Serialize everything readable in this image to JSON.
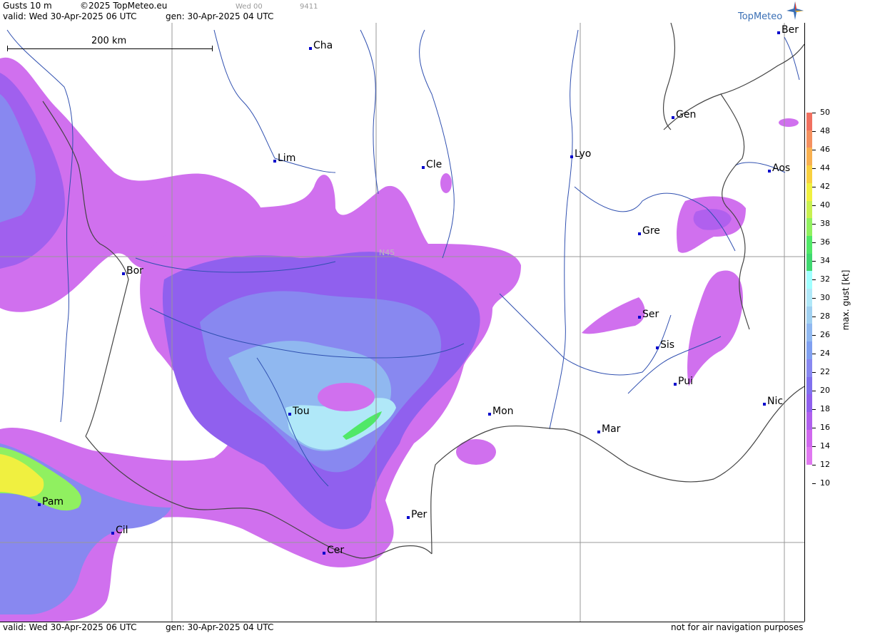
{
  "header": {
    "product": "Gusts 10 m",
    "copyright": "©2025 TopMeteo.eu",
    "step": "Wed 00",
    "code": "9411",
    "valid": "valid:  Wed  30-Apr-2025  06 UTC",
    "gen": "gen: 30-Apr-2025 04 UTC",
    "brand": "TopMeteo"
  },
  "map": {
    "scale_label": "200 km",
    "grid_label": "N45",
    "cities": [
      {
        "name": "Cha"
      },
      {
        "name": "Ber"
      },
      {
        "name": "Gen"
      },
      {
        "name": "Lim"
      },
      {
        "name": "Cle"
      },
      {
        "name": "Lyo"
      },
      {
        "name": "Aos"
      },
      {
        "name": "Gre"
      },
      {
        "name": "Bor"
      },
      {
        "name": "Ser"
      },
      {
        "name": "Sis"
      },
      {
        "name": "Pui"
      },
      {
        "name": "Tou"
      },
      {
        "name": "Mon"
      },
      {
        "name": "Nic"
      },
      {
        "name": "Mar"
      },
      {
        "name": "Pam"
      },
      {
        "name": "Per"
      },
      {
        "name": "Cil"
      },
      {
        "name": "Cer"
      }
    ]
  },
  "legend": {
    "title": "max. gust  [kt]",
    "ticks": [
      "50",
      "48",
      "46",
      "44",
      "42",
      "40",
      "38",
      "36",
      "34",
      "32",
      "30",
      "28",
      "26",
      "24",
      "22",
      "20",
      "18",
      "16",
      "14",
      "12",
      "10"
    ],
    "colors": [
      "#f07060",
      "#f49060",
      "#f8b050",
      "#f8d040",
      "#f0f040",
      "#c8f050",
      "#90f060",
      "#50e868",
      "#40d870",
      "#a0ffff",
      "#b0e8f8",
      "#a0d0f0",
      "#90b8f0",
      "#80a0f0",
      "#8888f0",
      "#8070ee",
      "#9060ee",
      "#b060ee",
      "#d068ee",
      "#e078f0"
    ]
  },
  "footer": {
    "valid": "valid:  Wed  30-Apr-2025  06 UTC",
    "gen": "gen: 30-Apr-2025 04 UTC",
    "note": "not for air navigation purposes"
  }
}
